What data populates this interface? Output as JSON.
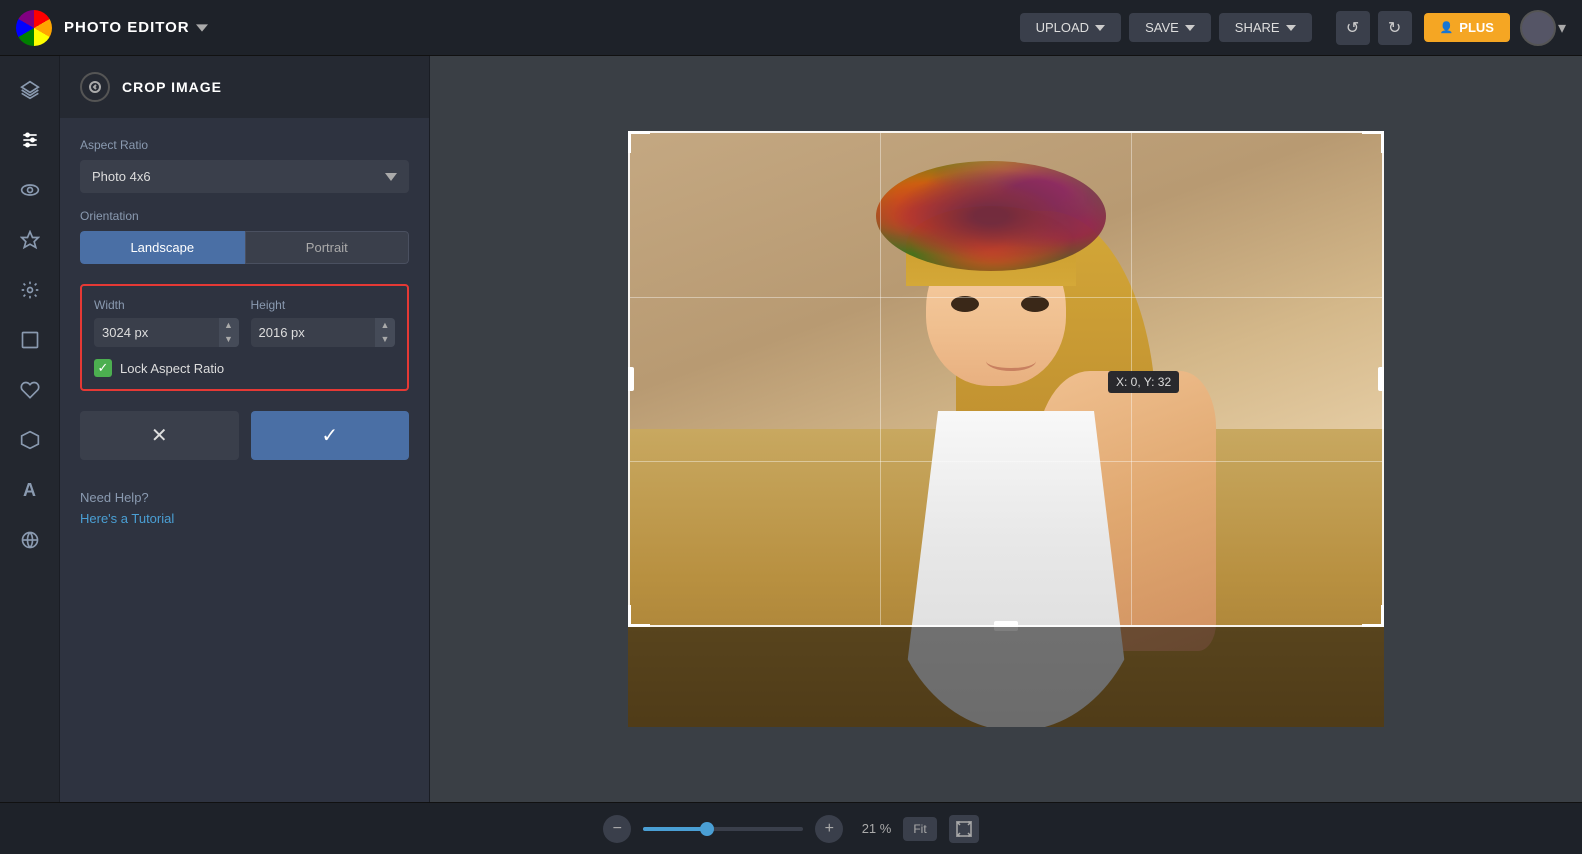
{
  "app": {
    "title": "PHOTO EDITOR",
    "logo_alt": "BeFunky logo"
  },
  "topbar": {
    "upload_label": "UPLOAD",
    "save_label": "SAVE",
    "share_label": "SHARE",
    "plus_label": "PLUS"
  },
  "panel": {
    "title": "CROP IMAGE",
    "aspect_ratio_label": "Aspect Ratio",
    "aspect_ratio_value": "Photo 4x6",
    "orientation_label": "Orientation",
    "landscape_label": "Landscape",
    "portrait_label": "Portrait",
    "width_label": "Width",
    "height_label": "Height",
    "width_value": "3024 px",
    "height_value": "2016 px",
    "lock_aspect_label": "Lock Aspect Ratio",
    "help_text": "Need Help?",
    "tutorial_link": "Here's a Tutorial"
  },
  "canvas": {
    "coordinate_tooltip": "X: 0, Y: 32"
  },
  "bottombar": {
    "zoom_percent": "21 %",
    "fit_label": "Fit"
  },
  "sidebar_icons": [
    {
      "name": "layers-icon",
      "symbol": "⊞"
    },
    {
      "name": "adjust-icon",
      "symbol": "⚙"
    },
    {
      "name": "effects-icon",
      "symbol": "◎"
    },
    {
      "name": "favorites-icon",
      "symbol": "★"
    },
    {
      "name": "tools-icon",
      "symbol": "✦"
    },
    {
      "name": "crop-icon",
      "symbol": "▭"
    },
    {
      "name": "heart-icon",
      "symbol": "♡"
    },
    {
      "name": "shape-icon",
      "symbol": "⬡"
    },
    {
      "name": "text-icon",
      "symbol": "A"
    },
    {
      "name": "texture-icon",
      "symbol": "⊗"
    }
  ]
}
